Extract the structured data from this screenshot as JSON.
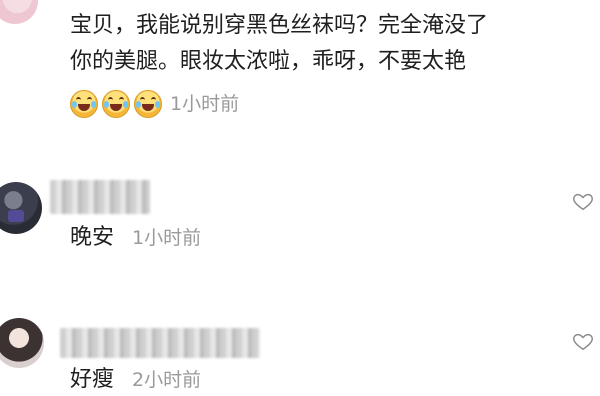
{
  "comments": [
    {
      "line1": "宝贝，我能说别穿黑色丝袜吗？完全淹没了",
      "line2": "你的美腿。眼妆太浓啦，乖呀，不要太艳",
      "reaction": "laughing-with-tears x3",
      "time": "1小时前"
    },
    {
      "text": "晚安",
      "time": "1小时前"
    },
    {
      "text": "好瘦",
      "time": "2小时前"
    }
  ],
  "icons": {
    "like": "heart-outline-icon",
    "avatar": "avatar"
  },
  "colors": {
    "text": "#1f1f1f",
    "meta": "#9a9a9a",
    "background": "#ffffff"
  }
}
